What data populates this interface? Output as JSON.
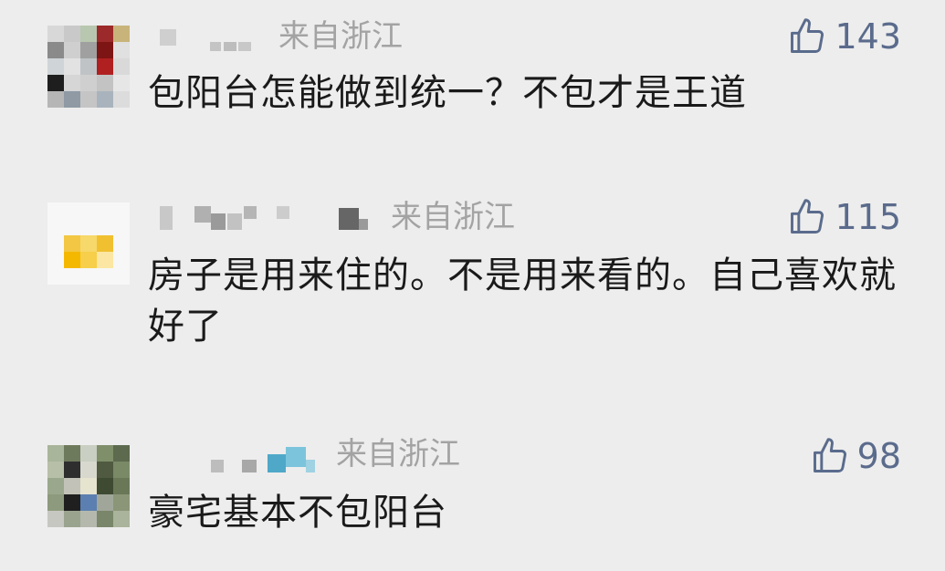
{
  "comments": [
    {
      "location": "来自浙江",
      "likes": "143",
      "text": "包阳台怎能做到统一？不包才是王道"
    },
    {
      "location": "来自浙江",
      "likes": "115",
      "text": "房子是用来住的。不是用来看的。自己喜欢就好了"
    },
    {
      "location": "来自浙江",
      "likes": "98",
      "text": "豪宅基本不包阳台"
    }
  ],
  "icons": {
    "like": "thumbs-up-icon"
  },
  "colors": {
    "background": "#ededed",
    "location_text": "#a3a3a3",
    "like_blue": "#5a6b8c",
    "comment_text": "#1a1a1a"
  }
}
